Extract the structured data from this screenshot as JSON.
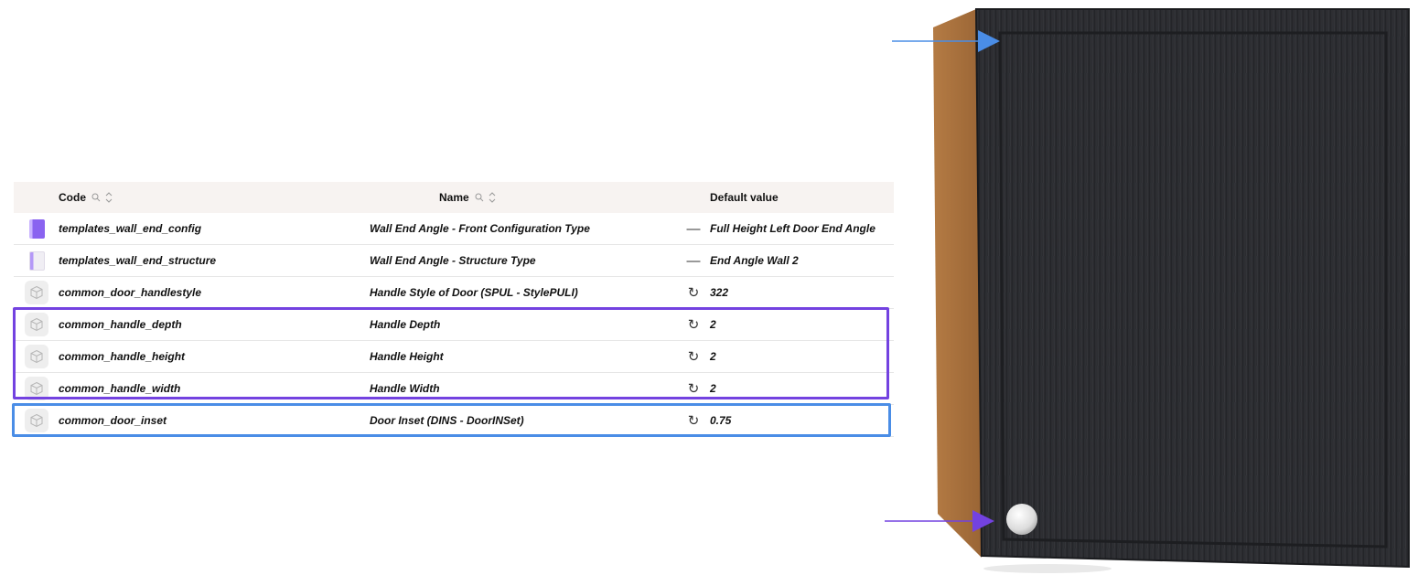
{
  "table": {
    "headers": {
      "code": "Code",
      "name": "Name",
      "default": "Default value"
    },
    "rows": [
      {
        "icon": "purple-template-icon",
        "code": "templates_wall_end_config",
        "name": "Wall End Angle - Front Configuration Type",
        "mark": "—",
        "default": "Full Height Left Door End Angle"
      },
      {
        "icon": "template-icon",
        "code": "templates_wall_end_structure",
        "name": "Wall End Angle - Structure Type",
        "mark": "—",
        "default": "End Angle Wall 2"
      },
      {
        "icon": "cube-icon",
        "code": "common_door_handlestyle",
        "name": "Handle Style of Door (SPUL - StylePULI)",
        "mark": "↻",
        "default": "322"
      },
      {
        "icon": "cube-icon",
        "code": "common_handle_depth",
        "name": "Handle Depth",
        "mark": "↻",
        "default": "2"
      },
      {
        "icon": "cube-icon",
        "code": "common_handle_height",
        "name": "Handle Height",
        "mark": "↻",
        "default": "2"
      },
      {
        "icon": "cube-icon",
        "code": "common_handle_width",
        "name": "Handle Width",
        "mark": "↻",
        "default": "2"
      },
      {
        "icon": "cube-icon",
        "code": "common_door_inset",
        "name": "Door Inset (DINS - DoorINSet)",
        "mark": "↻",
        "default": "0.75"
      }
    ]
  },
  "colors": {
    "highlight_purple": "#7342e0",
    "highlight_blue": "#4a8de6",
    "door": "#2a2b2f",
    "side_panel": "#a8713e"
  }
}
